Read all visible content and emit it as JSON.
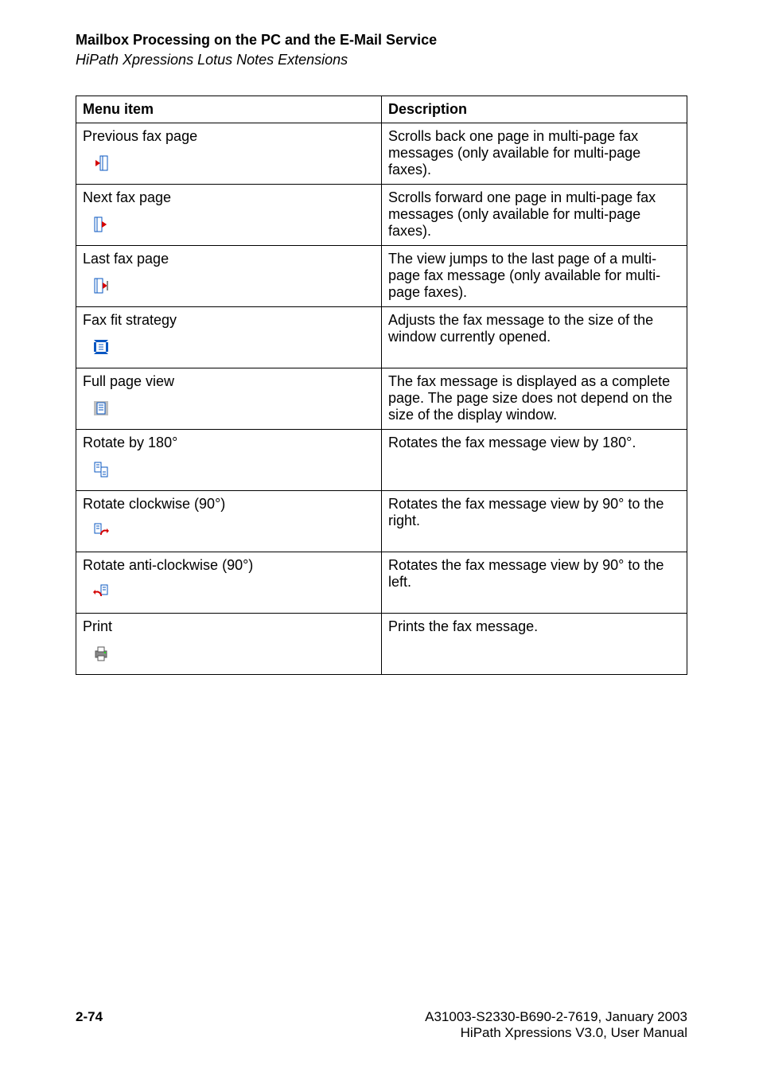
{
  "header": {
    "title": "Mailbox Processing on the PC and the E-Mail Service",
    "subtitle": "HiPath Xpressions Lotus Notes Extensions"
  },
  "table": {
    "headers": {
      "menu": "Menu item",
      "desc": "Description"
    },
    "rows": [
      {
        "label": "Previous fax page",
        "icon": "prev-page-icon",
        "desc": "Scrolls back one page in multi-page fax messages (only available for multi-page faxes)."
      },
      {
        "label": "Next fax page",
        "icon": "next-page-icon",
        "desc": "Scrolls forward one page in multi-page fax messages (only available for multi-page faxes)."
      },
      {
        "label": "Last fax page",
        "icon": "last-page-icon",
        "desc": "The view jumps to the last page of a multi-page fax message (only available for multi-page faxes)."
      },
      {
        "label": "Fax fit strategy",
        "icon": "fit-strategy-icon",
        "desc": "Adjusts the fax message to the size of the window currently opened."
      },
      {
        "label": "Full page view",
        "icon": "full-page-icon",
        "desc": "The fax message is displayed as a complete page. The page size does not depend on the size of the display window."
      },
      {
        "label": "Rotate by 180°",
        "icon": "rotate-180-icon",
        "desc": "Rotates the fax message view by 180°."
      },
      {
        "label": "Rotate clockwise (90°)",
        "icon": "rotate-cw-icon",
        "desc": "Rotates the fax message view by 90° to the right."
      },
      {
        "label": "Rotate anti-clockwise (90°)",
        "icon": "rotate-ccw-icon",
        "desc": "Rotates the fax message view by 90° to the left."
      },
      {
        "label": "Print",
        "icon": "print-icon",
        "desc": "Prints the fax message."
      }
    ]
  },
  "footer": {
    "page_number": "2-74",
    "line1": "A31003-S2330-B690-2-7619, January 2003",
    "line2": "HiPath Xpressions V3.0, User Manual"
  }
}
